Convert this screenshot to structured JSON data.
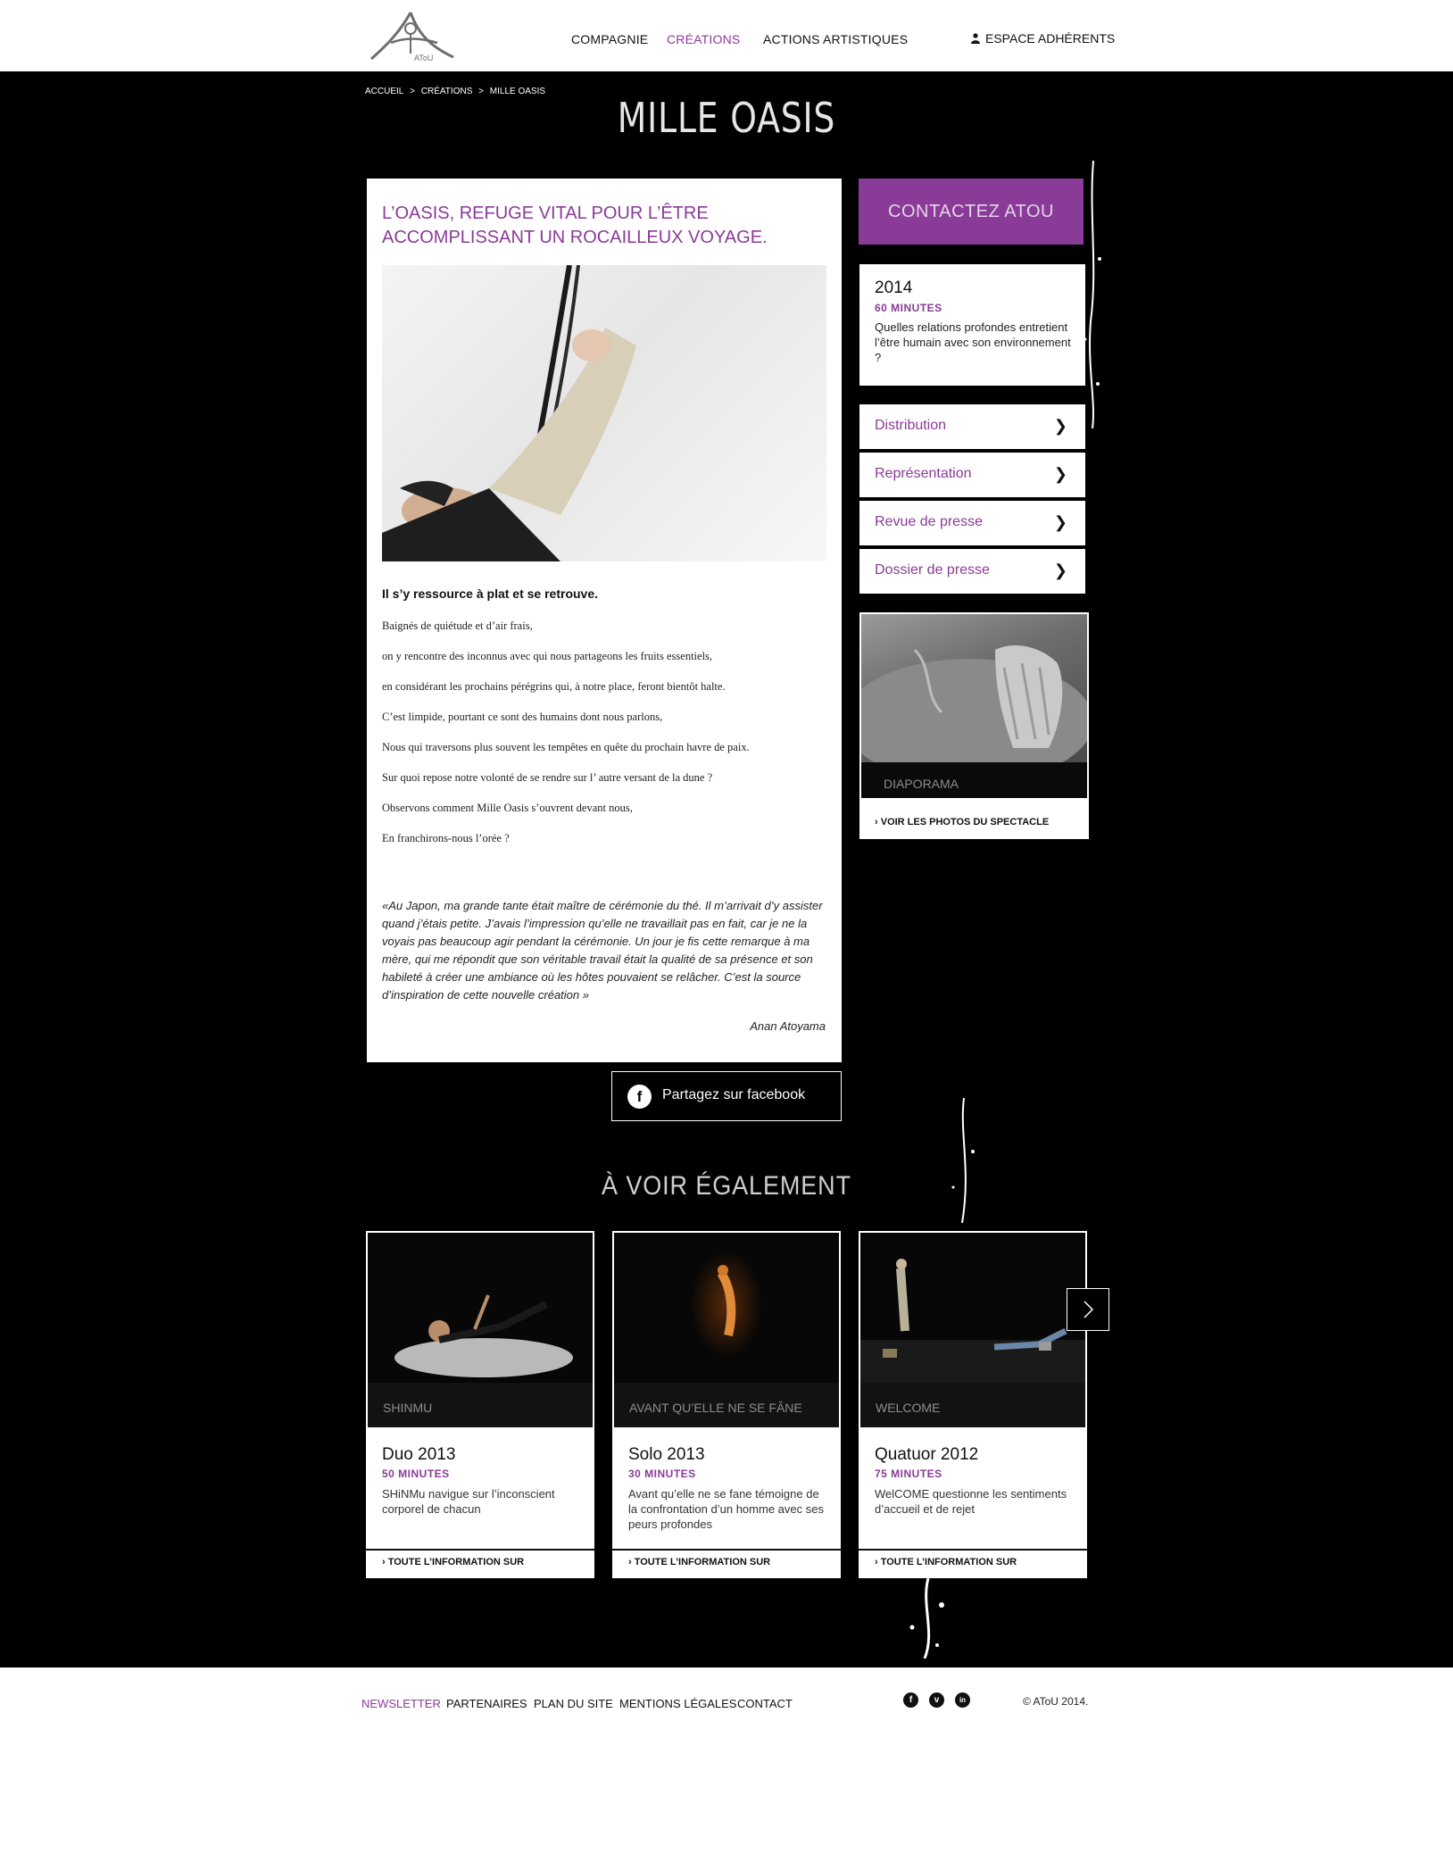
{
  "header": {
    "logo_text": "AToU",
    "nav": [
      {
        "label": "Compagnie",
        "active": false
      },
      {
        "label": "Créations",
        "active": true
      },
      {
        "label": "Actions artistiques",
        "active": false
      }
    ],
    "member_label": "Espace adhérents"
  },
  "breadcrumb": [
    "Accueil",
    ">",
    "Créations",
    ">",
    "Mille Oasis"
  ],
  "page_title": "MILLE OASIS",
  "article": {
    "lede": "L’oasis, refuge vital pour l’être accomplissant un rocailleux voyage.",
    "subhead": "Il s’y ressource à plat et se retrouve.",
    "verses": [
      "Baignés de quiétude et d’air frais,",
      "on y rencontre des inconnus avec qui nous partageons les fruits essentiels,",
      "en considérant les prochains pérégrins qui, à notre place, feront bientôt halte.",
      "C’est limpide, pourtant ce sont des humains dont nous parlons,",
      "Nous qui traversons plus souvent les tempêtes en quête du prochain havre de paix.",
      "Sur quoi repose notre volonté de se rendre sur l’ autre versant de la dune ?",
      "Observons comment Mille Oasis s’ouvrent devant nous,",
      "En franchirons-nous l’orée ?"
    ],
    "quote": "«Au Japon, ma grande tante était maître de cérémonie du thé. Il m’arrivait d’y assister quand j’étais petite. J’avais l’impression qu’elle ne travaillait pas en fait, car je ne la voyais pas beaucoup agir pendant la cérémonie. Un jour je fis cette remarque à ma mère, qui me répondit que son véritable travail était la qualité de sa présence et son habileté à créer une ambiance où les hôtes pouvaient se relâcher. C’est la source d’inspiration de cette nouvelle création »",
    "author": "Anan Atoyama"
  },
  "share": {
    "label": "Partagez sur facebook",
    "icon": "facebook-icon"
  },
  "sidebar": {
    "contact_label": "Contactez ATOU",
    "info": {
      "year": "2014",
      "duration": "60 MINUTES",
      "description": "Quelles relations profondes entretient l’être humain avec son environnement ?"
    },
    "links": [
      {
        "label": "Distribution"
      },
      {
        "label": "Représentation"
      },
      {
        "label": "Revue de presse"
      },
      {
        "label": "Dossier de presse"
      }
    ],
    "diaporama": {
      "label": "Diaporama",
      "more": "Voir les photos du spectacle"
    }
  },
  "see_also": {
    "title": "À voir également",
    "cards": [
      {
        "band": "SHiNMu",
        "year": "Duo 2013",
        "duration": "50 MINUTES",
        "description": "SHiNMu navigue sur l’inconscient corporel de chacun",
        "more": "Toute l’information sur"
      },
      {
        "band": "Avant qu’elle ne se fâne",
        "year": "Solo 2013",
        "duration": "30 MINUTES",
        "description": "Avant qu’elle ne se fane témoigne de la confrontation d’un homme avec ses peurs profondes",
        "more": "Toute l’information sur"
      },
      {
        "band": "WelCOME",
        "year": "Quatuor 2012",
        "duration": "75 MINUTES",
        "description": "WelCOME questionne les sentiments d’accueil et de rejet",
        "more": "Toute l’information sur"
      }
    ]
  },
  "footer": {
    "links": [
      {
        "label": "Newsletter",
        "active": true
      },
      {
        "label": "Partenaires",
        "active": false
      },
      {
        "label": "Plan du site",
        "active": false
      },
      {
        "label": "Mentions légales",
        "active": false
      },
      {
        "label": "Contact",
        "active": false
      }
    ],
    "social": [
      {
        "icon": "facebook-icon",
        "glyph": "f"
      },
      {
        "icon": "vimeo-icon",
        "glyph": "v"
      },
      {
        "icon": "linkedin-icon",
        "glyph": "in"
      }
    ],
    "copyright": "© AToU 2014."
  },
  "colors": {
    "accent": "#8a3b97",
    "background_dark": "#000000",
    "background_light": "#ffffff"
  }
}
